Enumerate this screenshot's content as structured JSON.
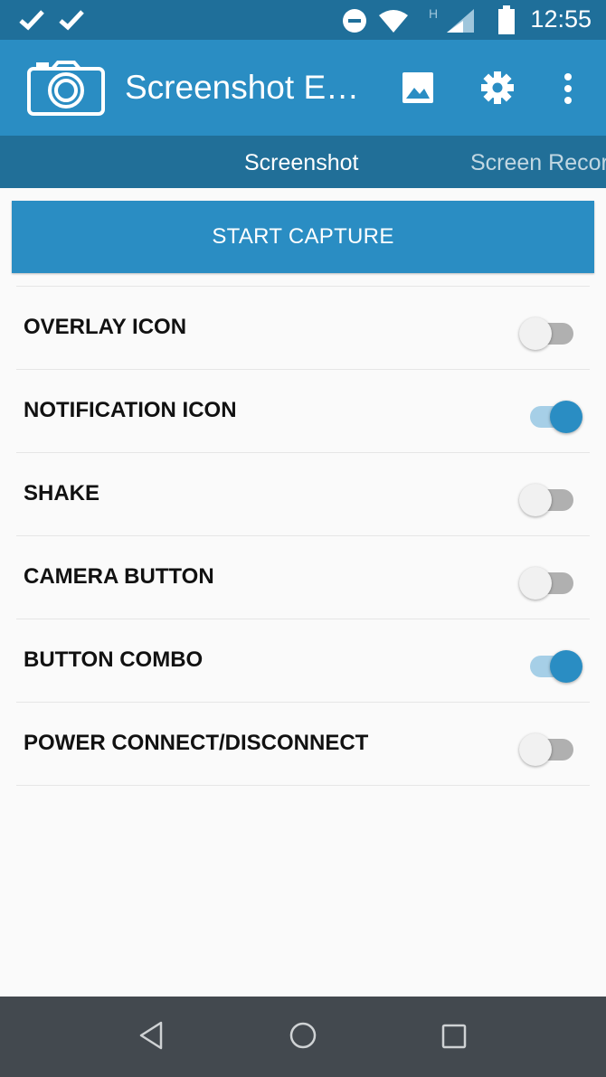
{
  "status_bar": {
    "time": "12:55",
    "icons": [
      "check-icon",
      "check-icon",
      "do-not-disturb-icon",
      "wifi-icon",
      "signal-h-icon",
      "battery-icon"
    ]
  },
  "app_bar": {
    "title": "Screenshot Easy",
    "logo": "camera-logo-icon",
    "actions": [
      "gallery-icon",
      "settings-gear-icon",
      "overflow-menu-icon"
    ],
    "color": "#2a8dc3"
  },
  "tabs": [
    {
      "label": "Screenshot",
      "active": true
    },
    {
      "label": "Screen Recorder",
      "active": false
    }
  ],
  "capture_button": {
    "label": "START CAPTURE"
  },
  "settings": [
    {
      "label": "OVERLAY ICON",
      "enabled": false
    },
    {
      "label": "NOTIFICATION ICON",
      "enabled": true
    },
    {
      "label": "SHAKE",
      "enabled": false
    },
    {
      "label": "CAMERA BUTTON",
      "enabled": false
    },
    {
      "label": "BUTTON COMBO",
      "enabled": true
    },
    {
      "label": "POWER CONNECT/DISCONNECT",
      "enabled": false
    }
  ],
  "nav_bar": {
    "buttons": [
      "back-icon",
      "home-icon",
      "recents-icon"
    ]
  }
}
